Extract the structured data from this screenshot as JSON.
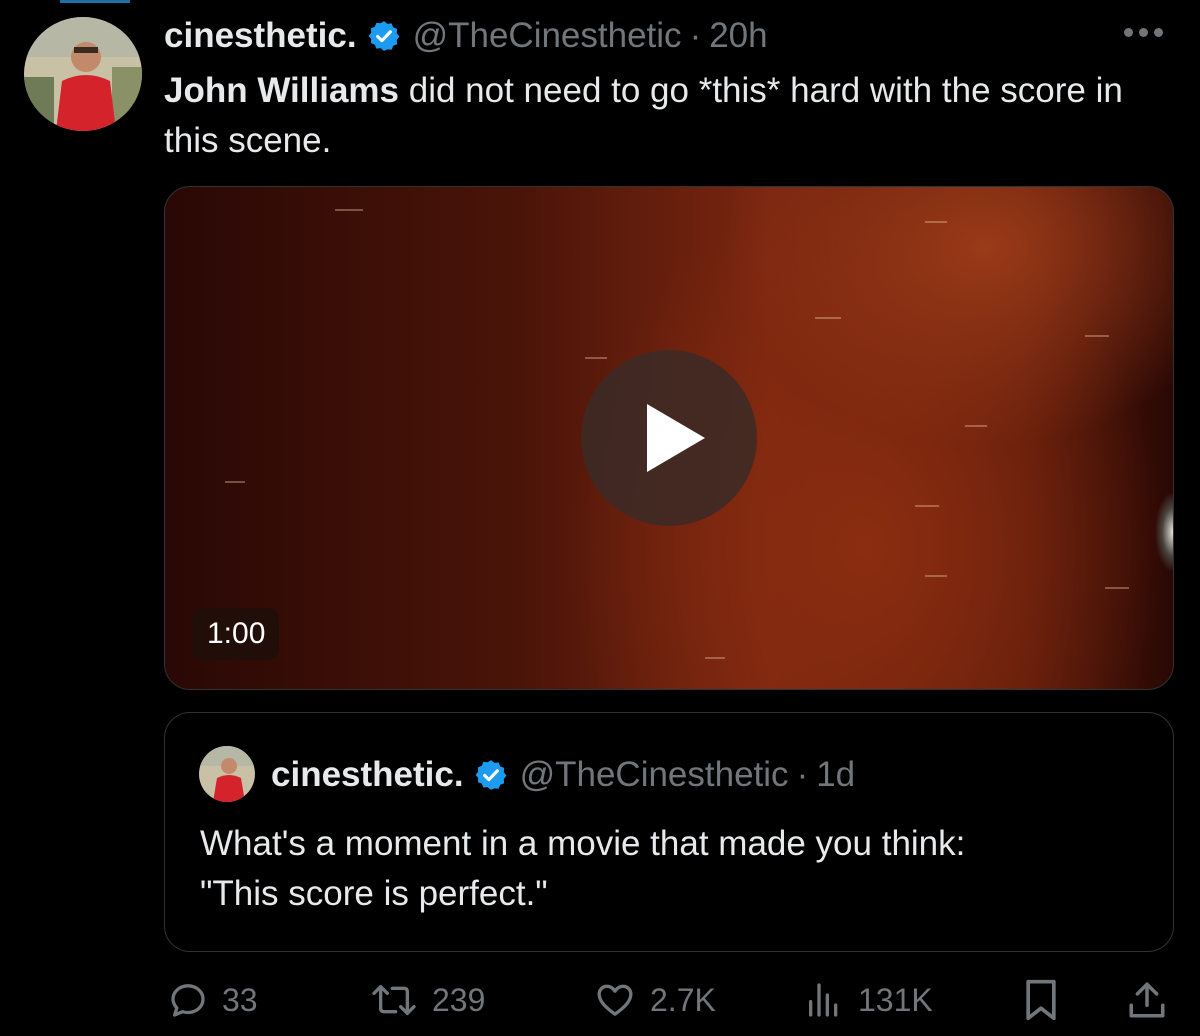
{
  "tweet": {
    "display_name": "cinesthetic.",
    "handle": "@TheCinesthetic",
    "separator": "·",
    "time": "20h",
    "text_bold": "John Williams",
    "text_rest": " did not need to go *this* hard with the score in this scene.",
    "icons": {
      "verified": "verified-badge-icon",
      "more": "more-options-icon"
    },
    "colors": {
      "verified": "#1d9bf0",
      "text": "#e7e9ea",
      "muted": "#71767b"
    }
  },
  "video": {
    "duration": "1:00",
    "play_icon": "play-icon"
  },
  "quoted_tweet": {
    "display_name": "cinesthetic.",
    "handle": "@TheCinesthetic",
    "separator": "·",
    "time": "1d",
    "text_line1": "What's a moment in a movie that made you think:",
    "text_line2": "\"This score is perfect.\""
  },
  "actions": {
    "reply": {
      "icon": "reply-icon",
      "count": "33"
    },
    "retweet": {
      "icon": "retweet-icon",
      "count": "239"
    },
    "like": {
      "icon": "heart-icon",
      "count": "2.7K"
    },
    "views": {
      "icon": "views-chart-icon",
      "count": "131K"
    },
    "bookmark": {
      "icon": "bookmark-icon"
    },
    "share": {
      "icon": "share-icon"
    }
  }
}
